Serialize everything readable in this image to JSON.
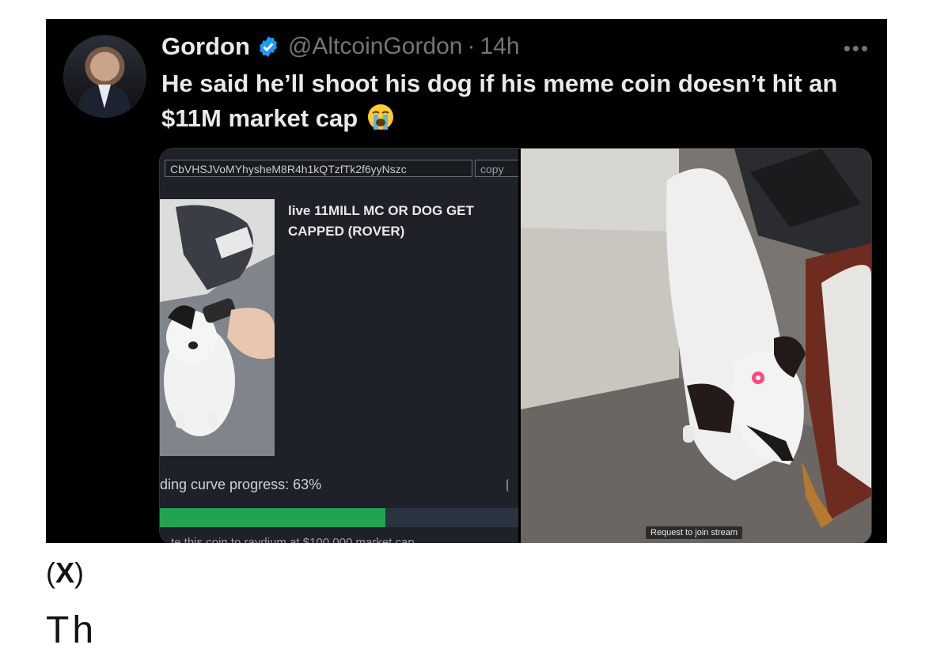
{
  "tweet": {
    "author_name": "Gordon",
    "handle": "@AltcoinGordon",
    "separator": "·",
    "time": "14h",
    "more_label": "•••",
    "text": "He said he’ll shoot his dog if his meme coin doesn’t hit an $11M market cap",
    "emoji_icon": "loudly-crying-face-icon",
    "verified_icon": "verified-badge-icon",
    "verified_color": "#1d9bf0"
  },
  "media_left": {
    "address": "CbVHSJVoMYhysheM8R4h1kQTzfTk2f6yyNszc",
    "copy_label": "copy",
    "coin_title": "live 11MILL MC OR DOG GET CAPPED (ROVER)",
    "curve_label": "ding curve progress: 63%",
    "progress": 0.63,
    "progress_color": "#22a352",
    "cut_text": "te this coin to raydium at $100,000 market cap"
  },
  "media_right": {
    "stream_button": "Request to join stream"
  },
  "source": {
    "open": "(",
    "label": "X",
    "close": ")"
  },
  "partial_text": "Th"
}
